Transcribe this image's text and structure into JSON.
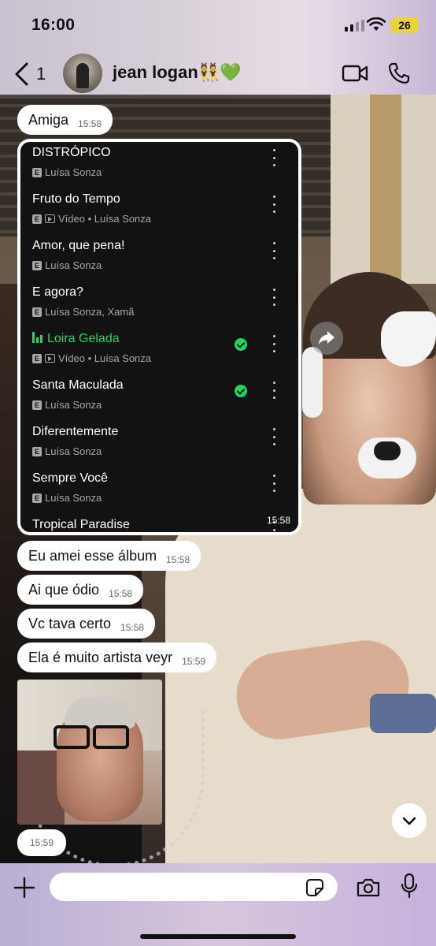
{
  "status_bar": {
    "time": "16:00",
    "battery": "26"
  },
  "header": {
    "back_count": "1",
    "contact_name": "jean logan",
    "contact_emoji": "👯💚"
  },
  "messages": [
    {
      "text": "Amiga",
      "time": "15:58"
    },
    {
      "text": "Eu amei esse álbum",
      "time": "15:58"
    },
    {
      "text": "Ai que ódio",
      "time": "15:58"
    },
    {
      "text": "Vc tava certo",
      "time": "15:58"
    },
    {
      "text": "Ela é muito artista veyr",
      "time": "15:59"
    }
  ],
  "playlist_image": {
    "time": "15:58",
    "tracks": [
      {
        "title": "DISTRÓPICO",
        "meta": "Luísa Sonza",
        "explicit": true,
        "video": false,
        "playing": false,
        "downloaded": false
      },
      {
        "title": "Fruto do Tempo",
        "meta": "Vídeo • Luísa Sonza",
        "explicit": true,
        "video": true,
        "playing": false,
        "downloaded": false
      },
      {
        "title": "Amor, que pena!",
        "meta": "Luísa Sonza",
        "explicit": true,
        "video": false,
        "playing": false,
        "downloaded": false
      },
      {
        "title": "E agora?",
        "meta": "Luísa Sonza, Xamã",
        "explicit": true,
        "video": false,
        "playing": false,
        "downloaded": false
      },
      {
        "title": "Loira Gelada",
        "meta": "Vídeo • Luísa Sonza",
        "explicit": true,
        "video": true,
        "playing": true,
        "downloaded": true
      },
      {
        "title": "Santa Maculada",
        "meta": "Luísa Sonza",
        "explicit": true,
        "video": false,
        "playing": false,
        "downloaded": true
      },
      {
        "title": "Diferentemente",
        "meta": "Luísa Sonza",
        "explicit": true,
        "video": false,
        "playing": false,
        "downloaded": false
      },
      {
        "title": "Sempre Você",
        "meta": "Luísa Sonza",
        "explicit": true,
        "video": false,
        "playing": false,
        "downloaded": false
      },
      {
        "title": "Tropical Paradise",
        "meta": "",
        "explicit": false,
        "video": false,
        "playing": false,
        "downloaded": false
      }
    ]
  },
  "photo_message": {
    "time": "15:59"
  },
  "composer": {
    "placeholder": ""
  },
  "colors": {
    "accent": "#1ed760",
    "bubble": "#ffffff",
    "playlist_bg": "#121212"
  }
}
